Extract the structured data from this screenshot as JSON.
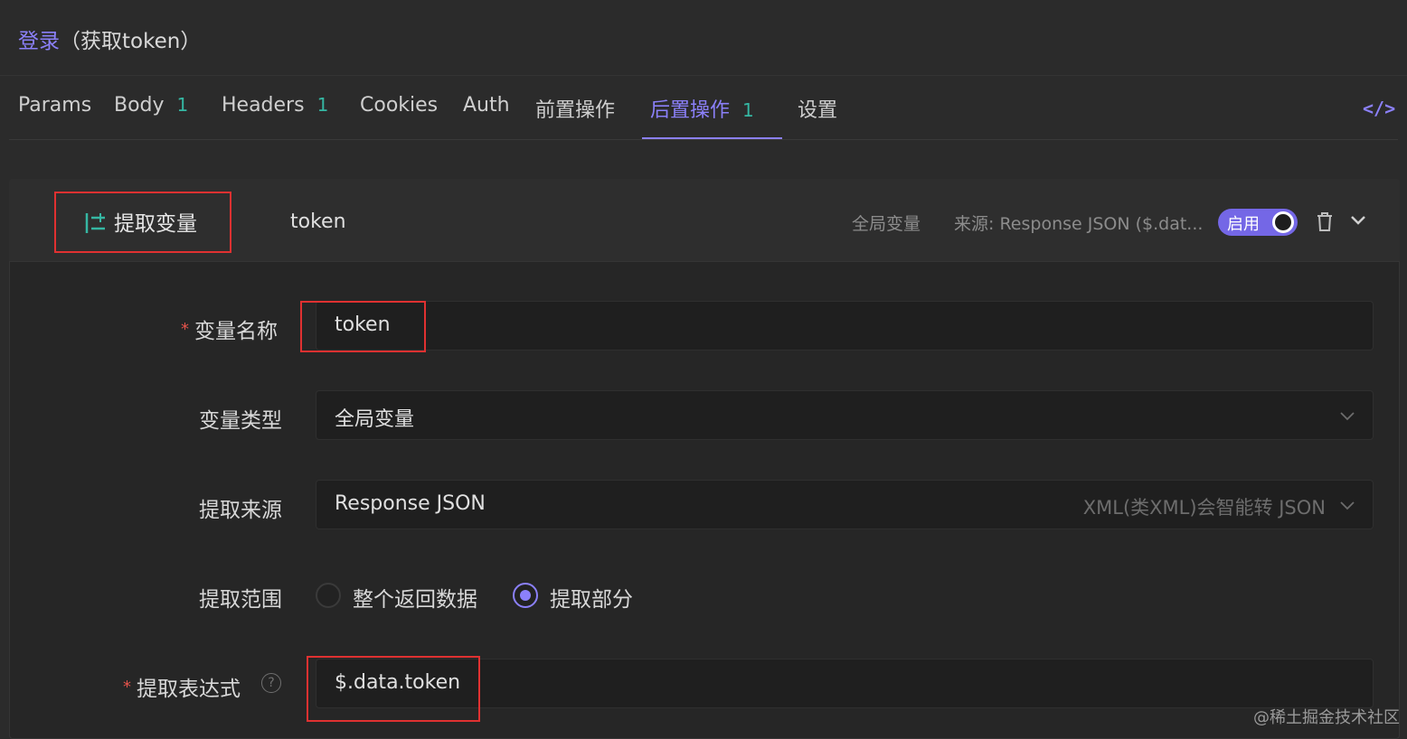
{
  "breadcrumb": {
    "link": "登录",
    "rest": "（获取token）"
  },
  "tabs": [
    {
      "label": "Params",
      "badge": ""
    },
    {
      "label": "Body",
      "badge": "1"
    },
    {
      "label": "Headers",
      "badge": "1"
    },
    {
      "label": "Cookies",
      "badge": ""
    },
    {
      "label": "Auth",
      "badge": ""
    },
    {
      "label": "前置操作",
      "badge": ""
    },
    {
      "label": "后置操作",
      "badge": "1",
      "active": true
    },
    {
      "label": "设置",
      "badge": ""
    }
  ],
  "code_button": "</>",
  "processor": {
    "type_label": "提取变量",
    "name": "token",
    "scope_text": "全局变量",
    "source_text": "来源: Response JSON ($.dat...",
    "toggle_label": "启用",
    "enabled": true
  },
  "form": {
    "var_name": {
      "label": "变量名称",
      "value": "token",
      "required": true
    },
    "var_type": {
      "label": "变量类型",
      "value": "全局变量"
    },
    "source": {
      "label": "提取来源",
      "value": "Response JSON",
      "hint": "XML(类XML)会智能转 JSON"
    },
    "range": {
      "label": "提取范围",
      "options": [
        "整个返回数据",
        "提取部分"
      ],
      "selected": "提取部分"
    },
    "expression": {
      "label": "提取表达式",
      "value": "$.data.token",
      "required": true
    }
  },
  "colors": {
    "accent": "#8b80f9",
    "badge": "#35b7a3",
    "highlight": "#e03131"
  },
  "watermark": "@稀土掘金技术社区"
}
